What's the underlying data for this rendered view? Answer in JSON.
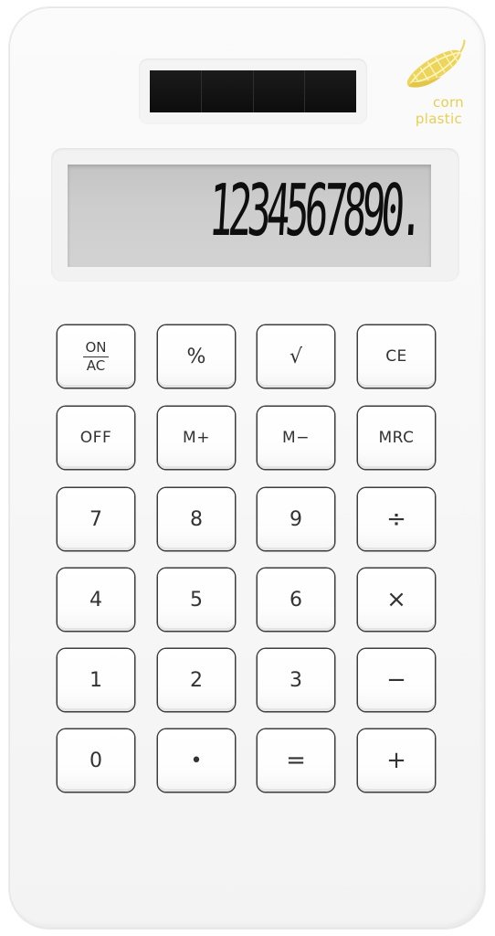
{
  "logo": {
    "line1": "corn",
    "line2": "plastic",
    "color": "#e7cf52",
    "icon": "corn-cob-icon"
  },
  "display": {
    "value": "1234567890."
  },
  "keys": {
    "row1": {
      "on": "ON",
      "ac": "AC",
      "percent": "%",
      "sqrt": "√",
      "ce": "CE"
    },
    "row2": {
      "off": "OFF",
      "mplus": "M+",
      "mminus": "M−",
      "mrc": "MRC"
    },
    "row3": {
      "k7": "7",
      "k8": "8",
      "k9": "9",
      "divide": "÷"
    },
    "row4": {
      "k4": "4",
      "k5": "5",
      "k6": "6",
      "multiply": "×"
    },
    "row5": {
      "k1": "1",
      "k2": "2",
      "k3": "3",
      "minus": "−"
    },
    "row6": {
      "k0": "0",
      "dot": "•",
      "equals": "=",
      "plus": "+"
    }
  }
}
